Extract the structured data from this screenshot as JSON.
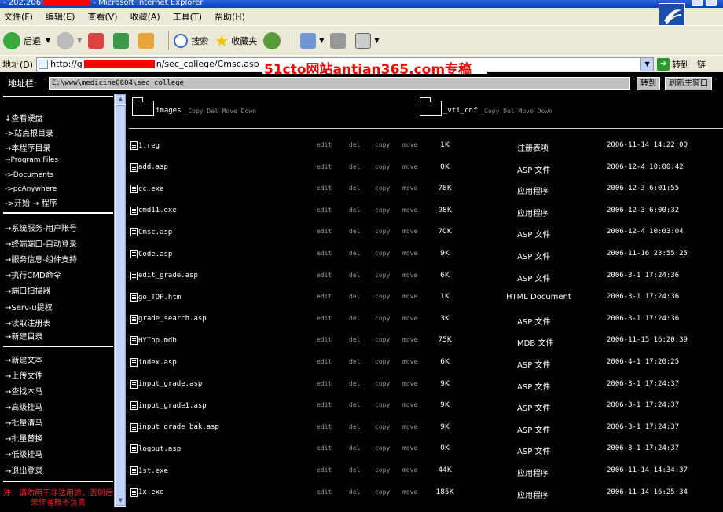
{
  "window": {
    "title_prefix": "- 202.206",
    "title_suffix": "- Microsoft Internet Explorer"
  },
  "menu": [
    "文件(F)",
    "编辑(E)",
    "查看(V)",
    "收藏(A)",
    "工具(T)",
    "帮助(H)"
  ],
  "toolbar": {
    "back": "后退",
    "search": "搜索",
    "favorites": "收藏夹"
  },
  "address": {
    "label": "地址(D)",
    "url_start": "http://g",
    "url_end": "n/sec_college/Cmsc.asp",
    "go": "转到",
    "links": "链"
  },
  "watermark": "51cto网站antian365.com专稿",
  "path_bar": {
    "label": "地址栏:",
    "value": "E:\\www\\medicine0604\\sec_college",
    "go_btn": "转到",
    "refresh_btn": "刷新主窗口"
  },
  "sidebar": {
    "group1": [
      "↓查看硬盘",
      "->站点根目录",
      "→本程序目录",
      "→Program Files",
      "->Documents",
      "->pcAnywhere",
      "->开始 → 程序"
    ],
    "group2": [
      "→系统服务-用户账号",
      "→终端端口-自动登录",
      "→服务信息-组件支持",
      "→执行CMD命令",
      "→端口扫描器",
      "→Serv-u提权",
      "→读取注册表",
      "→新建目录"
    ],
    "group3": [
      "→新建文本",
      "→上传文件",
      "→查找木马",
      "→高级挂马",
      "→批量清马",
      "→批量替换",
      "→低级挂马",
      "→退出登录"
    ],
    "warning": "注：请勿用于非法用途，否则后果作者概不负责"
  },
  "folders": [
    {
      "name": "images",
      "actions": "_Copy Del Move Down"
    },
    {
      "name": "_vti_cnf",
      "actions": "_Copy Del Move Down"
    }
  ],
  "actions": [
    "edit",
    "del",
    "copy",
    "move"
  ],
  "files": [
    {
      "name": "1.reg",
      "size": "1K",
      "type": "注册表项",
      "date": "2006-11-14 14:22:00"
    },
    {
      "name": "add.asp",
      "size": "0K",
      "type": "ASP 文件",
      "date": "2006-12-4 10:00:42"
    },
    {
      "name": "cc.exe",
      "size": "78K",
      "type": "应用程序",
      "date": "2006-12-3 6:01:55"
    },
    {
      "name": "cmd11.exe",
      "size": "98K",
      "type": "应用程序",
      "date": "2006-12-3 6:00:32"
    },
    {
      "name": "Cmsc.asp",
      "size": "70K",
      "type": "ASP 文件",
      "date": "2006-12-4 10:03:04"
    },
    {
      "name": "Code.asp",
      "size": "9K",
      "type": "ASP 文件",
      "date": "2006-11-16 23:55:25"
    },
    {
      "name": "edit_grade.asp",
      "size": "6K",
      "type": "ASP 文件",
      "date": "2006-3-1 17:24:36"
    },
    {
      "name": "go_TOP.htm",
      "size": "1K",
      "type": "HTML Document",
      "date": "2006-3-1 17:24:36"
    },
    {
      "name": "grade_search.asp",
      "size": "3K",
      "type": "ASP 文件",
      "date": "2006-3-1 17:24:36"
    },
    {
      "name": "HYTop.mdb",
      "size": "75K",
      "type": "MDB 文件",
      "date": "2006-11-15 16:20:39"
    },
    {
      "name": "index.asp",
      "size": "6K",
      "type": "ASP 文件",
      "date": "2006-4-1 17:20:25"
    },
    {
      "name": "input_grade.asp",
      "size": "9K",
      "type": "ASP 文件",
      "date": "2006-3-1 17:24:37"
    },
    {
      "name": "input_grade1.asp",
      "size": "9K",
      "type": "ASP 文件",
      "date": "2006-3-1 17:24:37"
    },
    {
      "name": "input_grade_bak.asp",
      "size": "9K",
      "type": "ASP 文件",
      "date": "2006-3-1 17:24:37"
    },
    {
      "name": "logout.asp",
      "size": "0K",
      "type": "ASP 文件",
      "date": "2006-3-1 17:24:37"
    },
    {
      "name": "1st.exe",
      "size": "44K",
      "type": "应用程序",
      "date": "2006-11-14 14:34:37"
    },
    {
      "name": "1x.exe",
      "size": "185K",
      "type": "应用程序",
      "date": "2006-11-14 16:25:34"
    }
  ]
}
